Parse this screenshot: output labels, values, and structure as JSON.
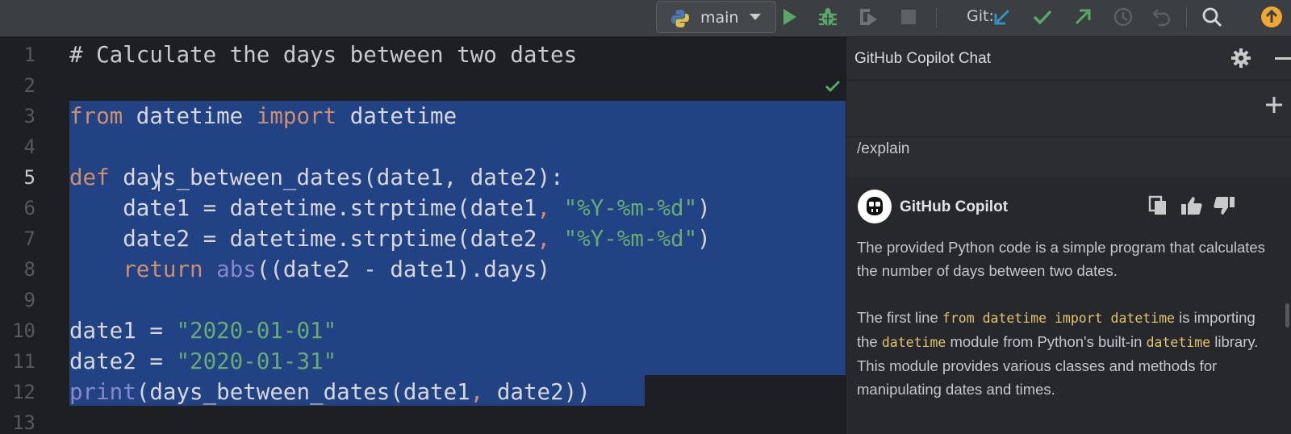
{
  "toolbar": {
    "branch_name": "main",
    "git_label": "Git:",
    "icons": [
      "python-icon",
      "dropdown-caret-icon",
      "run-icon",
      "debug-icon",
      "coverage-icon",
      "stop-icon",
      "git-update-icon",
      "git-commit-icon",
      "git-push-icon",
      "history-icon",
      "rollback-icon",
      "search-icon",
      "update-available-icon"
    ]
  },
  "editor": {
    "line_numbers": [
      "1",
      "2",
      "3",
      "4",
      "5",
      "6",
      "7",
      "8",
      "9",
      "10",
      "11",
      "12",
      "13"
    ],
    "current_line": "5",
    "code": {
      "l1": "# Calculate the days between two dates",
      "l3_from": "from",
      "l3_mod": " datetime ",
      "l3_import": "import",
      "l3_name": " datetime",
      "l5_def": "def",
      "l5_rest": " days_between_dates(date1, date2):",
      "l6_a": "    date1 = datetime.strptime(date1",
      "l6_comma": ",",
      "l6_str": " \"%Y-%m-%d\"",
      "l6_close": ")",
      "l7_a": "    date2 = datetime.strptime(date2",
      "l7_comma": ",",
      "l7_str": " \"%Y-%m-%d\"",
      "l7_close": ")",
      "l8_indent": "    ",
      "l8_return": "return",
      "l8_sp": " ",
      "l8_abs": "abs",
      "l8_rest": "((date2 - date1).days)",
      "l10_a": "date1 = ",
      "l10_str": "\"2020-01-01\"",
      "l11_a": "date2 = ",
      "l11_str": "\"2020-01-31\"",
      "l12_print": "print",
      "l12_a": "(days_between_dates(date1",
      "l12_comma": ",",
      "l12_b": " date2))"
    }
  },
  "copilot": {
    "title": "GitHub Copilot Chat",
    "prompt": "/explain",
    "responder": "GitHub Copilot",
    "p1": "The provided Python code is a simple program that calculates the number of days between two dates.",
    "p2": {
      "t1": "The first line ",
      "c1": "from datetime import datetime",
      "t2": " is importing the ",
      "c2": "datetime",
      "t3": " module from Python's built-in ",
      "c3": "datetime",
      "t4": " library. This module provides various classes and methods for manipulating dates and times."
    }
  },
  "colors": {
    "selection": "#214283",
    "keyword": "#cf8e6d",
    "string": "#6aab73",
    "run_green": "#59a869",
    "git_blue": "#3592c4",
    "update_orange": "#f0a732"
  }
}
